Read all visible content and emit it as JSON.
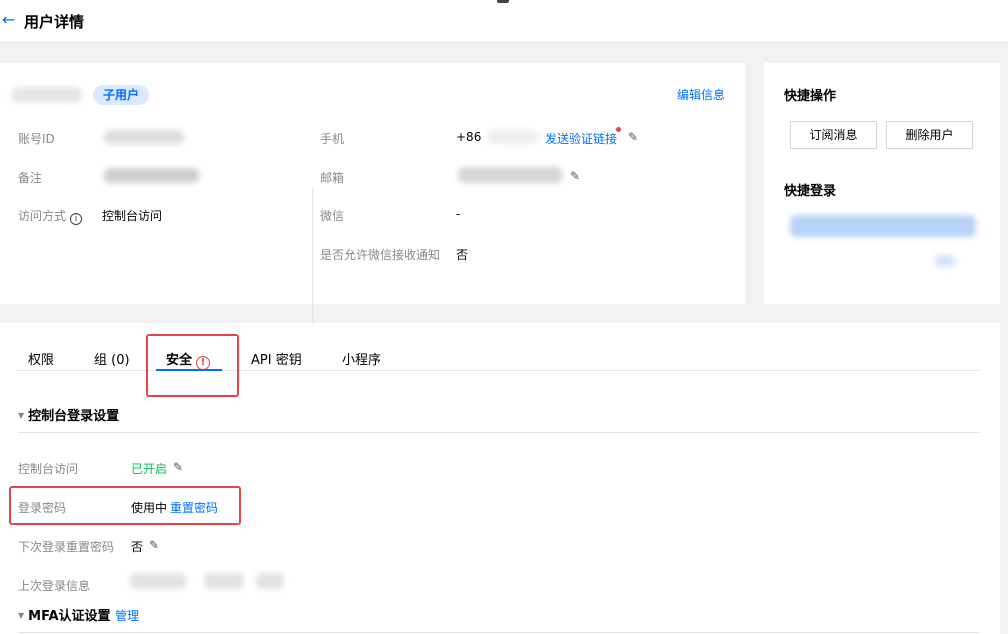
{
  "header": {
    "back_icon": "arrow-left-icon",
    "title": "用户详情"
  },
  "info": {
    "badge": "子用户",
    "edit_link": "编辑信息",
    "left": [
      {
        "label": "账号ID",
        "value": ""
      },
      {
        "label": "备注",
        "value": ""
      },
      {
        "label": "访问方式",
        "value": "控制台访问"
      }
    ],
    "right": {
      "phone_label": "手机",
      "phone_prefix": "+86",
      "send_link": "发送验证链接",
      "email_label": "邮箱",
      "wechat_label": "微信",
      "wechat_value": "-",
      "notify_label": "是否允许微信接收通知",
      "notify_value": "否"
    }
  },
  "side": {
    "quick_ops_title": "快捷操作",
    "subscribe_button": "订阅消息",
    "delete_button": "删除用户",
    "quick_login_title": "快捷登录"
  },
  "tabs": {
    "items": [
      "权限",
      "组 (0)",
      "安全",
      "API 密钥",
      "小程序"
    ],
    "active": "安全"
  },
  "security": {
    "console_section": "控制台登录设置",
    "console_access_label": "控制台访问",
    "console_access_value": "已开启",
    "password_label": "登录密码",
    "password_value": "使用中",
    "reset_password_link": "重置密码",
    "next_reset_label": "下次登录重置密码",
    "next_reset_value": "否",
    "last_login_label": "上次登录信息",
    "mfa_section": "MFA认证设置",
    "mfa_manage_link": "管理"
  },
  "colors": {
    "accent": "#006eff",
    "success": "#0abf5b",
    "danger": "#e54545"
  }
}
